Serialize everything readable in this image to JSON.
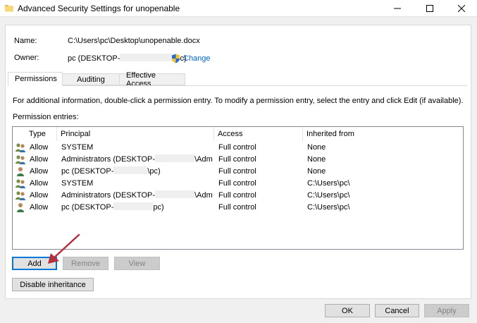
{
  "window": {
    "title": "Advanced Security Settings for unopenable"
  },
  "info": {
    "name_label": "Name:",
    "name_value": "C:\\Users\\pc\\Desktop\\unopenable.docx",
    "owner_label": "Owner:",
    "owner_prefix": "pc (DESKTOP-",
    "owner_suffix": "\\pc)",
    "change_label": "Change"
  },
  "tabs": [
    {
      "label": "Permissions",
      "active": true
    },
    {
      "label": "Auditing",
      "active": false
    },
    {
      "label": "Effective Access",
      "active": false
    }
  ],
  "permissions": {
    "description": "For additional information, double-click a permission entry. To modify a permission entry, select the entry and click Edit (if available).",
    "entries_label": "Permission entries:",
    "columns": {
      "type": "Type",
      "principal": "Principal",
      "access": "Access",
      "inherited": "Inherited from"
    },
    "rows": [
      {
        "icon": "group-users-icon",
        "type": "Allow",
        "principal_a": "SYSTEM",
        "principal_b": "",
        "access": "Full control",
        "inherited": "None"
      },
      {
        "icon": "group-users-icon",
        "type": "Allow",
        "principal_a": "Administrators (DESKTOP-",
        "principal_b": "\\Admi...",
        "access": "Full control",
        "inherited": "None"
      },
      {
        "icon": "single-user-icon",
        "type": "Allow",
        "principal_a": "pc (DESKTOP-",
        "principal_b": "\\pc)",
        "access": "Full control",
        "inherited": "None"
      },
      {
        "icon": "group-users-icon",
        "type": "Allow",
        "principal_a": "SYSTEM",
        "principal_b": "",
        "access": "Full control",
        "inherited": "C:\\Users\\pc\\"
      },
      {
        "icon": "group-users-icon",
        "type": "Allow",
        "principal_a": "Administrators (DESKTOP-",
        "principal_b": "\\Admi...",
        "access": "Full control",
        "inherited": "C:\\Users\\pc\\"
      },
      {
        "icon": "single-user-icon",
        "type": "Allow",
        "principal_a": "pc (DESKTOP-",
        "principal_b": "pc)",
        "access": "Full control",
        "inherited": "C:\\Users\\pc\\"
      }
    ]
  },
  "buttons": {
    "add": "Add",
    "remove": "Remove",
    "view": "View",
    "disable_inheritance": "Disable inheritance",
    "ok": "OK",
    "cancel": "Cancel",
    "apply": "Apply"
  },
  "colors": {
    "link": "#0066cc",
    "focus": "#0078d7",
    "annotation_arrow": "#b5303d"
  }
}
